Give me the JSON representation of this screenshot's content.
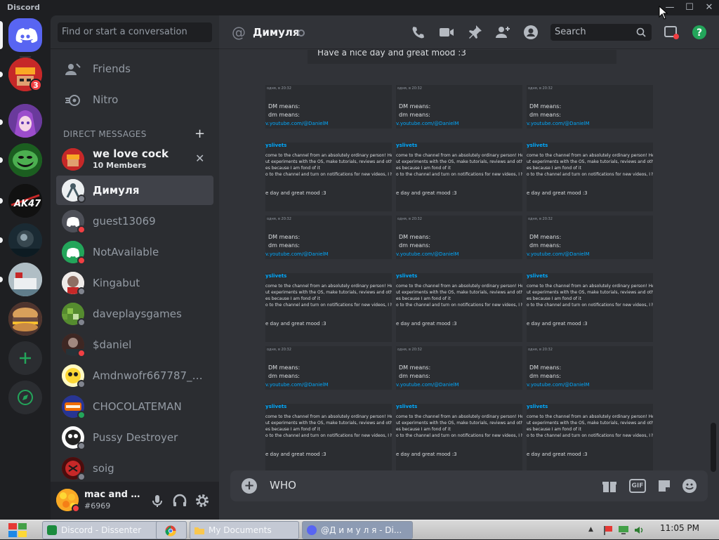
{
  "window": {
    "title": "Discord",
    "minimize": "—",
    "maximize": "☐",
    "close": "✕"
  },
  "servers": [
    {
      "name": "home",
      "color": "#5865f2"
    },
    {
      "name": "server-1",
      "badge": "3"
    },
    {
      "name": "server-2"
    },
    {
      "name": "server-3"
    },
    {
      "name": "server-4",
      "text": "AK47"
    },
    {
      "name": "server-5"
    },
    {
      "name": "server-6"
    },
    {
      "name": "server-7"
    }
  ],
  "sidebar": {
    "search_placeholder": "Find or start a conversation",
    "nav": [
      {
        "label": "Friends",
        "icon": "friends-icon"
      },
      {
        "label": "Nitro",
        "icon": "nitro-icon"
      }
    ],
    "dm_header": "DIRECT MESSAGES",
    "dm_add": "+",
    "dms": [
      {
        "name": "we love cock",
        "sub": "10 Members",
        "status": "",
        "group": true
      },
      {
        "name": "Димуля",
        "status": "offline",
        "active": true
      },
      {
        "name": "guest13069",
        "status": "dnd"
      },
      {
        "name": "NotAvailable",
        "status": "dnd"
      },
      {
        "name": "Kingabut",
        "status": "offline"
      },
      {
        "name": "daveplaysgames",
        "status": "offline"
      },
      {
        "name": "$daniel",
        "status": "dnd"
      },
      {
        "name": "Amdnwofr667787_im...",
        "status": "offline"
      },
      {
        "name": "CHOCOLATEMAN",
        "status": "online"
      },
      {
        "name": "Pussy Destroyer",
        "status": "offline"
      },
      {
        "name": "soig",
        "status": "offline"
      }
    ]
  },
  "user": {
    "name": "mac and c...",
    "tag": "#6969"
  },
  "header": {
    "title": "Димуля",
    "search_placeholder": "Search"
  },
  "messages": {
    "top": "Have a nice day and great mood :3",
    "tile": {
      "time": "одня, в 20:32",
      "dm1": "DM means:",
      "dm2": "dm means:",
      "link": "v.youtube.com/@DanielM",
      "chan": "yslivets",
      "l1": "come to the channel from an absolutely ordinary person! Here",
      "l2": "ut experiments with the OS, make tutorials, reviews and other",
      "l3": "es because I am fond of it",
      "l4": "o to the channel and turn on notifications for new videos, I hope",
      "mood": "e day and great mood :3"
    }
  },
  "composer": {
    "text": "WHO",
    "gif": "GIF"
  },
  "taskbar": {
    "tasks": [
      {
        "label": "Discord - Dissenter"
      },
      {
        "label": ""
      },
      {
        "label": "My Documents"
      },
      {
        "label": "@Д и м у л я  - Di..."
      }
    ],
    "clock": "11:05 PM"
  },
  "colors": {
    "blurple": "#5865f2",
    "online": "#23a55a",
    "dnd": "#f23f43",
    "offline": "#80848e",
    "link": "#00a8fc"
  }
}
